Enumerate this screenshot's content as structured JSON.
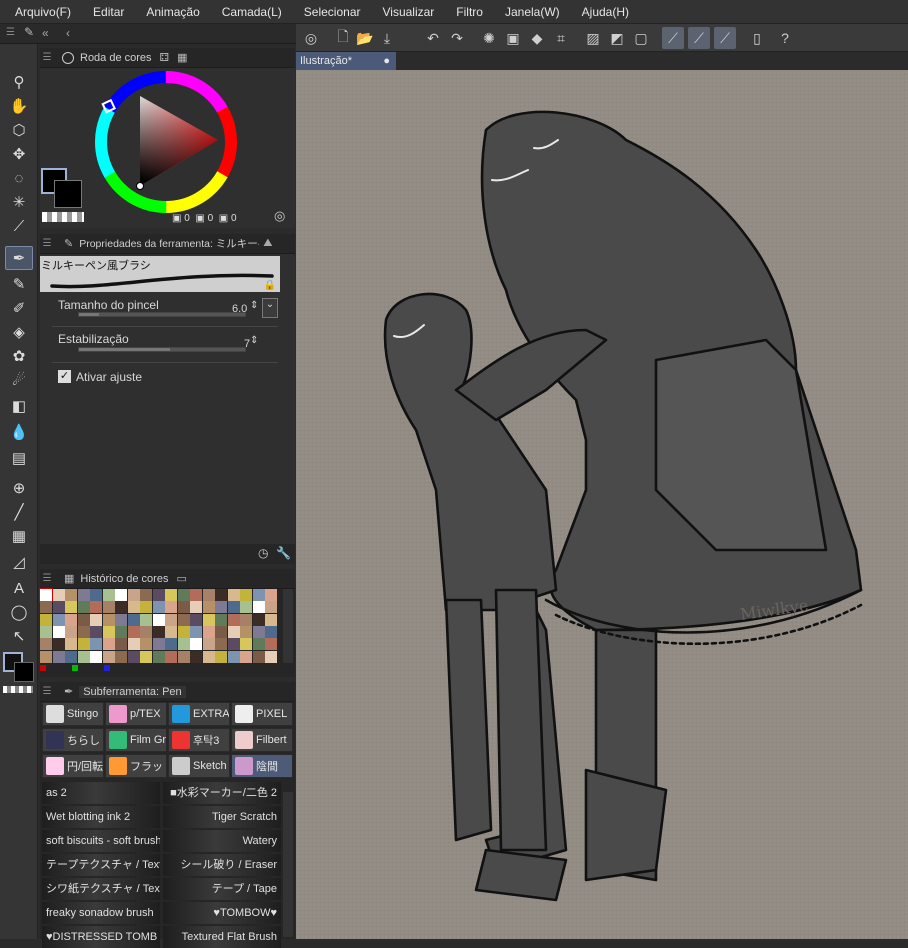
{
  "menu": [
    "Arquivo(F)",
    "Editar",
    "Animação",
    "Camada(L)",
    "Selecionar",
    "Visualizar",
    "Filtro",
    "Janela(W)",
    "Ajuda(H)"
  ],
  "document": {
    "tab_title": "Ilustração*"
  },
  "color_panel": {
    "tab_label": "Roda de cores",
    "readout": {
      "h": "0",
      "s": "0",
      "v": "0"
    }
  },
  "tool_properties": {
    "tab_label": "Propriedades da ferramenta: ミルキーペン風",
    "brush_name": "ミルキーペン風ブラシ",
    "brush_size_label": "Tamanho do pincel",
    "brush_size_value": "6.0",
    "brush_size_fraction": 0.12,
    "stabilization_label": "Estabilização",
    "stabilization_value": "7",
    "stabilization_fraction": 0.55,
    "snap_label": "Ativar ajuste",
    "snap_checked": true
  },
  "color_history": {
    "tab_label": "Histórico de cores"
  },
  "subtool": {
    "tab_label": "Subferramenta: Pen",
    "groups": [
      "Stingo",
      "p/TEX",
      "EXTRA",
      "PIXEL",
      "ちらし",
      "Film Gr",
      "후탁3",
      "Filbert",
      "円/回転",
      "フラット",
      "Sketch",
      "陰間"
    ],
    "brushes_left": [
      "as 2",
      "Wet blotting ink 2",
      "soft biscuits - soft brush",
      "テープテクスチャ / Textur",
      "シワ紙テクスチャ / Textur",
      "freaky sonadow brush",
      "♥DISTRESSED TOMB"
    ],
    "brushes_right": [
      "■水彩マーカー/二色 2",
      "Tiger Scratch",
      "Watery",
      "シール破り / Eraser",
      "テープ / Tape",
      "♥TOMBOW♥",
      "Textured Flat Brush"
    ]
  },
  "canvas": {
    "signature": "Miwlkye"
  },
  "colors": {
    "accent": "#4a5a78",
    "canvas_bg": "#928c85",
    "figure": "#4a4a4a"
  }
}
